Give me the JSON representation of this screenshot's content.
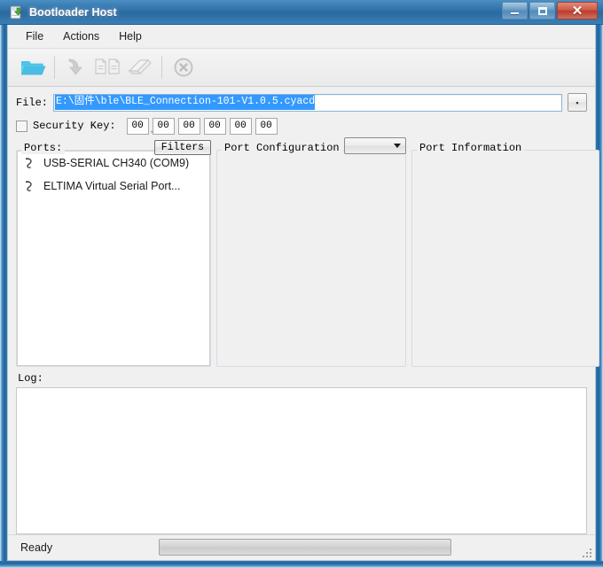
{
  "window": {
    "title": "Bootloader Host",
    "app_icon": "bootloader-document-download-icon",
    "buttons": {
      "minimize": "minimize-icon",
      "maximize": "maximize-icon",
      "close": "✕"
    }
  },
  "menu": {
    "items": [
      {
        "label": "File",
        "name": "menu-file"
      },
      {
        "label": "Actions",
        "name": "menu-actions"
      },
      {
        "label": "Help",
        "name": "menu-help"
      }
    ]
  },
  "toolbar": {
    "buttons": [
      {
        "name": "open-file-icon",
        "label": "Open File",
        "enabled": true
      },
      {
        "name": "program-download-icon",
        "label": "Program",
        "enabled": false
      },
      {
        "name": "verify-documents-icon",
        "label": "Verify",
        "enabled": false
      },
      {
        "name": "erase-eraser-icon",
        "label": "Erase",
        "enabled": false
      },
      {
        "name": "abort-circle-x-icon",
        "label": "Abort",
        "enabled": false
      }
    ]
  },
  "file": {
    "label": "File:",
    "value": "E:\\固件\\ble\\BLE_Connection-101-V1.0.5.cyacd",
    "selected": true,
    "browse_label": "▪"
  },
  "security_key": {
    "label": "Security Key:",
    "checked": false,
    "separator": ",",
    "fields": [
      "00",
      "00",
      "00",
      "00",
      "00",
      "00"
    ]
  },
  "ports": {
    "title": "Ports:",
    "filters_label": "Filters",
    "items": [
      {
        "label": "USB-SERIAL CH340 (COM9)",
        "icon": "serial-port-icon"
      },
      {
        "label": "ELTIMA Virtual Serial Port...",
        "icon": "serial-port-icon"
      }
    ]
  },
  "port_configuration": {
    "title": "Port Configuration",
    "selected_option": "",
    "options": []
  },
  "port_information": {
    "title": "Port Information",
    "content": ""
  },
  "log": {
    "title": "Log:",
    "content": ""
  },
  "status": {
    "text": "Ready",
    "progress_percent": 0
  },
  "colors": {
    "title_bar": "#2e6fa6",
    "selection": "#3399ff",
    "accent_icon": "#5bc0de",
    "close_button": "#c04a38"
  }
}
